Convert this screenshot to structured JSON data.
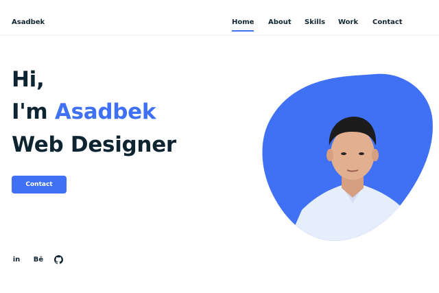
{
  "header": {
    "logo": "Asadbek",
    "nav": [
      {
        "label": "Home",
        "active": true
      },
      {
        "label": "About",
        "active": false
      },
      {
        "label": "Skills",
        "active": false
      },
      {
        "label": "Work",
        "active": false
      },
      {
        "label": "Contact",
        "active": false
      }
    ]
  },
  "hero": {
    "greeting": "Hi,",
    "intro": "I'm ",
    "name": "Asadbek",
    "role": "Web Designer",
    "button_label": "Contact"
  },
  "social": {
    "linkedin": "in",
    "behance": "Bē",
    "github_icon": "github-icon"
  },
  "colors": {
    "accent": "#4070f4",
    "text": "#0e2431"
  }
}
